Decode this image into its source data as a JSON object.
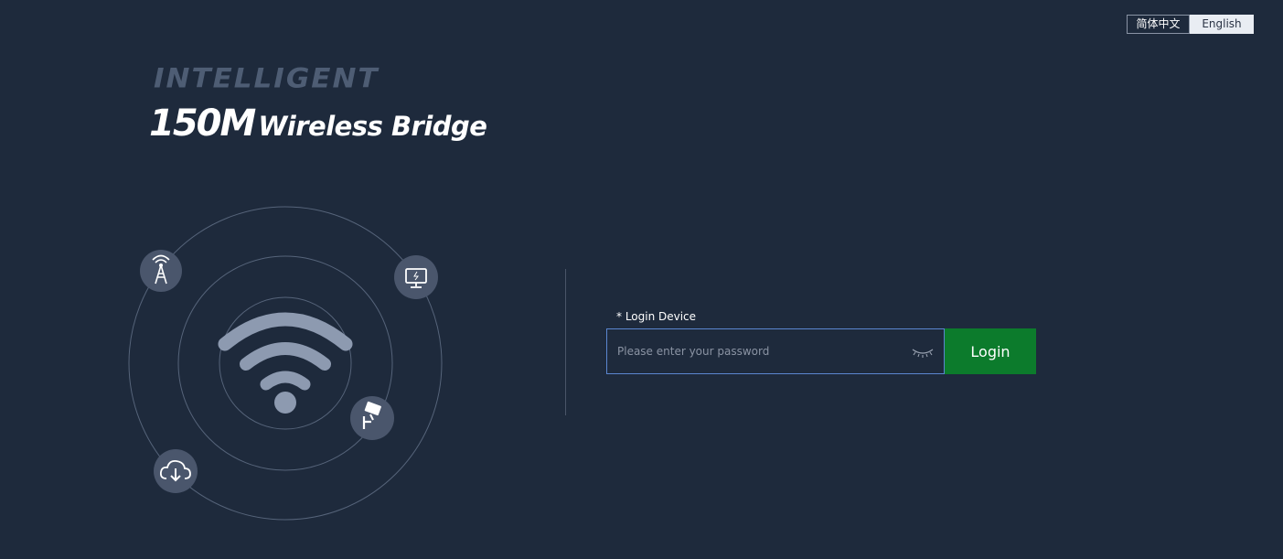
{
  "language": {
    "options": [
      {
        "label": "简体中文",
        "active": false
      },
      {
        "label": "English",
        "active": true
      }
    ]
  },
  "brand": {
    "tagline": "INTELLIGENT",
    "speed": "150M",
    "product": "Wireless Bridge"
  },
  "illustration": {
    "icons": [
      "wifi-icon",
      "antenna-tower-icon",
      "monitor-icon",
      "security-camera-icon",
      "cloud-download-icon"
    ]
  },
  "login": {
    "label": "* Login Device",
    "placeholder": "Please enter your password",
    "value": "",
    "button": "Login"
  },
  "colors": {
    "background": "#1e2a3c",
    "accent_button": "#0c7b2c",
    "input_border": "#5b86d0",
    "icon_circle": "#4a566c"
  }
}
